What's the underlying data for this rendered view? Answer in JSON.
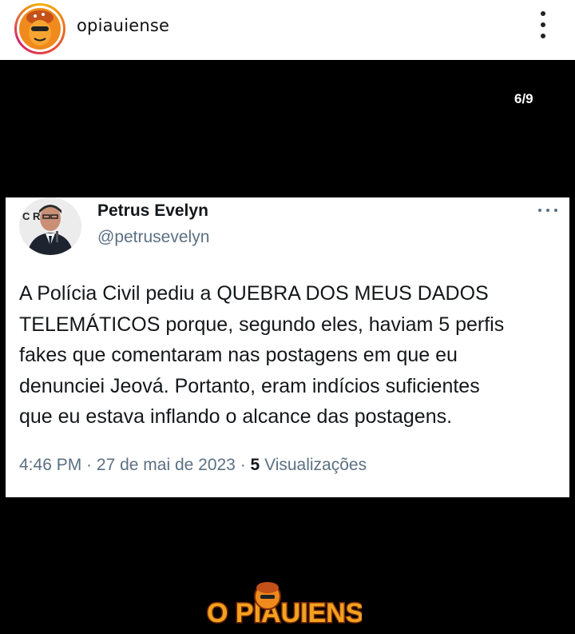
{
  "header": {
    "username": "opiauiense"
  },
  "post": {
    "slide_counter": "6/9"
  },
  "tweet": {
    "name": "Petrus Evelyn",
    "handle": "@petrusevelyn",
    "text": "A Polícia Civil pediu a QUEBRA DOS MEUS DADOS\nTELEMÁTICOS porque, segundo eles, haviam 5 perfis\nfakes que comentaram nas postagens em que eu\ndenunciei Jeová. Portanto, eram indícios suficientes\nque eu estava inflando o alcance das postagens.",
    "time": "4:46 PM",
    "date": "27 de mai de 2023",
    "views_count": "5",
    "views_label": "Visualizações",
    "avatar_bg_text": "C RUI"
  },
  "brand": {
    "logo_text": "O PIAUIENSE"
  },
  "colors": {
    "accent_orange": "#f08a1c",
    "secondary_text": "#5b7083"
  }
}
